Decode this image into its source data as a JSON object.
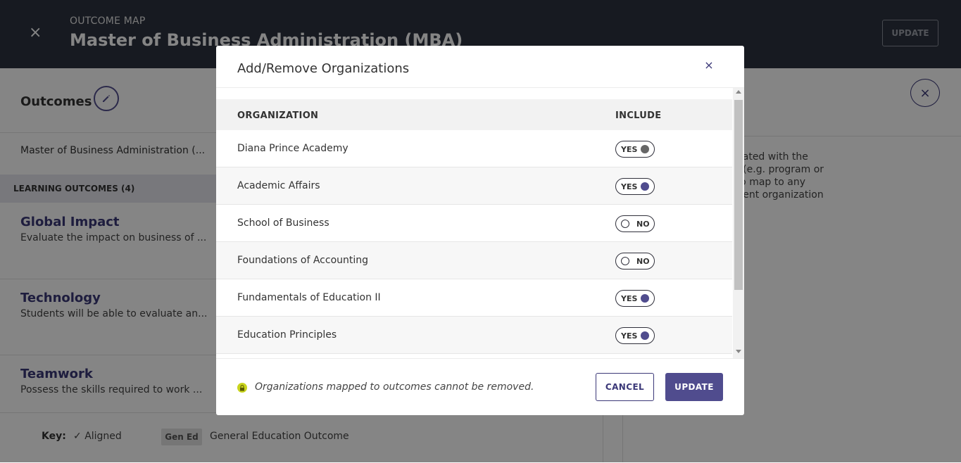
{
  "colors": {
    "header_bg": "#2d3340",
    "accent": "#504c8e",
    "link_purple": "#3b3878",
    "lock_badge": "#c9d41e"
  },
  "header": {
    "eyebrow": "OUTCOME MAP",
    "title": "Master of Business Administration (MBA)",
    "update_label": "UPDATE",
    "close_glyph": "×"
  },
  "left": {
    "outcomes_heading": "Outcomes",
    "program_name": "Master of Business Administration (...",
    "learning_outcomes_label": "LEARNING OUTCOMES (4)",
    "outcomes": [
      {
        "title": "Global Impact",
        "desc": "Evaluate the impact on business of ..."
      },
      {
        "title": "Technology",
        "desc": "Students will be able to evaluate an..."
      },
      {
        "title": "Teamwork",
        "desc": "Possess the skills required to work ..."
      }
    ],
    "key": {
      "label": "Key:",
      "aligned": "Aligned",
      "gen_ed_badge": "Gen Ed",
      "gen_ed_text": "General Education Outcome"
    }
  },
  "right": {
    "close_glyph": "×",
    "help_text": ", select the \"+\" associated with the\nd parent organization (e.g. program or\nere, you will be able to map to any\nssociated with the parent organization\ns side panel."
  },
  "modal": {
    "title": "Add/Remove Organizations",
    "close_glyph": "×",
    "col_org": "ORGANIZATION",
    "col_include": "INCLUDE",
    "rows": [
      {
        "name": "Diana Prince Academy",
        "include": "YES"
      },
      {
        "name": "Academic Affairs",
        "include": "YES"
      },
      {
        "name": "School of Business",
        "include": "NO"
      },
      {
        "name": "Foundations of Accounting",
        "include": "NO"
      },
      {
        "name": "Fundamentals of Education II",
        "include": "YES"
      },
      {
        "name": "Education Principles",
        "include": "YES"
      }
    ],
    "note": "Organizations mapped to outcomes cannot be removed.",
    "cancel_label": "CANCEL",
    "update_label": "UPDATE"
  },
  "icons": [
    "close-icon",
    "pencil-icon",
    "check-icon",
    "lock-icon",
    "scroll-up-icon",
    "scroll-down-icon"
  ]
}
